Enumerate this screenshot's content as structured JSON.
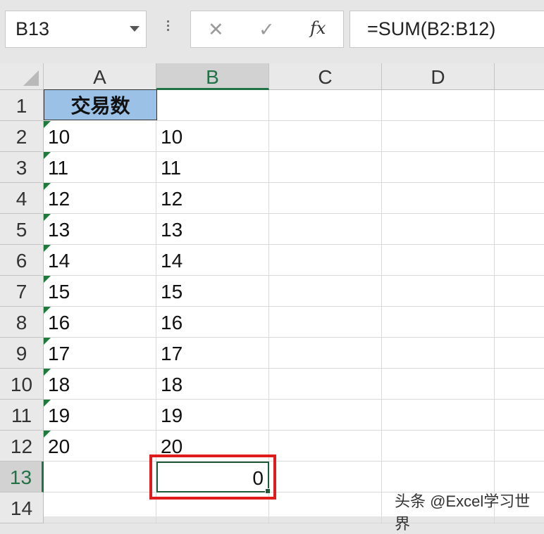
{
  "formula_bar": {
    "name_box": "B13",
    "cancel_icon": "close-icon",
    "enter_icon": "check-icon",
    "fx_label": "fx",
    "formula": "=SUM(B2:B12)"
  },
  "columns": [
    "A",
    "B",
    "C",
    "D"
  ],
  "active_column": "B",
  "rows": [
    "1",
    "2",
    "3",
    "4",
    "5",
    "6",
    "7",
    "8",
    "9",
    "10",
    "11",
    "12",
    "13",
    "14"
  ],
  "active_row": "13",
  "cells": {
    "A1": "交易数",
    "A": [
      "10",
      "11",
      "12",
      "13",
      "14",
      "15",
      "16",
      "17",
      "18",
      "19",
      "20"
    ],
    "B": [
      "10",
      "11",
      "12",
      "13",
      "14",
      "15",
      "16",
      "17",
      "18",
      "19",
      "20"
    ],
    "B13": "0"
  },
  "colors": {
    "header_fill": "#9bc2e6",
    "selection_green": "#217346",
    "highlight_red": "#e01b1b"
  },
  "watermark": "头条 @Excel学习世界"
}
